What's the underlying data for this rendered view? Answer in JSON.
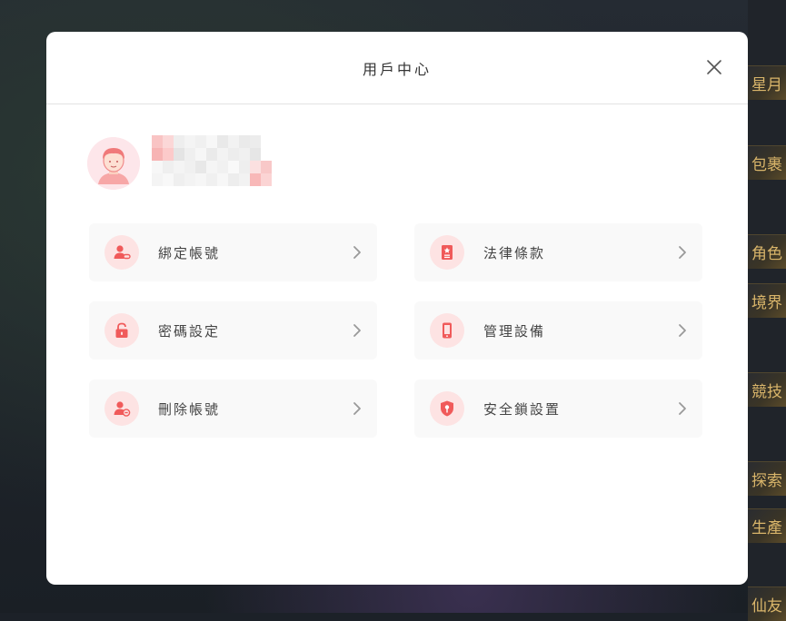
{
  "game_sidebar": {
    "tabs": [
      "星月",
      "包裹",
      "角色",
      "境界",
      "競技",
      "探索",
      "生產",
      "仙友"
    ]
  },
  "dialog": {
    "title": "用戶中心",
    "close_icon": "close-icon"
  },
  "profile": {
    "avatar_icon": "user-avatar-icon",
    "username_icon": "pixelated-username"
  },
  "menu": [
    {
      "label": "綁定帳號",
      "icon": "user-link-icon"
    },
    {
      "label": "法律條款",
      "icon": "document-badge-icon"
    },
    {
      "label": "密碼設定",
      "icon": "lock-icon"
    },
    {
      "label": "管理設備",
      "icon": "mobile-device-icon"
    },
    {
      "label": "刪除帳號",
      "icon": "user-remove-icon"
    },
    {
      "label": "安全鎖設置",
      "icon": "shield-key-icon"
    }
  ],
  "colors": {
    "accent": "#f05a5a",
    "icon_bg": "#fde3e3",
    "item_bg": "#f9f9f9"
  }
}
